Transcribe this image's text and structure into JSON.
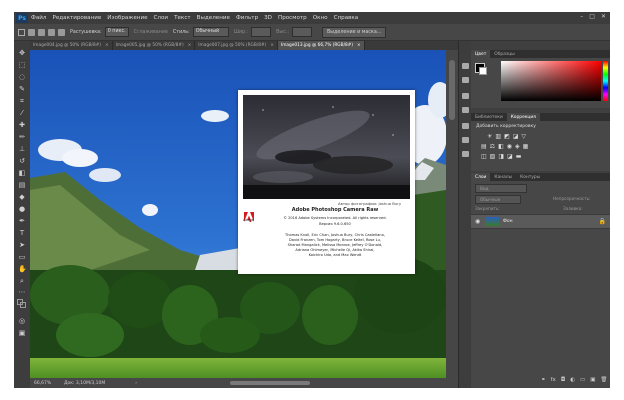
{
  "menu": {
    "logo": "Ps",
    "items": [
      "Файл",
      "Редактирование",
      "Изображение",
      "Слои",
      "Текст",
      "Выделение",
      "Фильтр",
      "3D",
      "Просмотр",
      "Окно",
      "Справка"
    ],
    "min": "–",
    "max": "□",
    "close": "✕"
  },
  "options": {
    "feather_label": "Растушевка:",
    "feather_value": "0 пикс.",
    "antialias_label": "Сглаживание",
    "style_label": "Стиль:",
    "style_value": "Обычный",
    "width_label": "Шир.:",
    "height_label": "Выс.:",
    "select_mask_button": "Выделение и маска..."
  },
  "tabs": [
    {
      "label": "Image004.jpg @ 50% (RGB/8#)",
      "active": false
    },
    {
      "label": "Image005.jpg @ 50% (RGB/8#)",
      "active": false
    },
    {
      "label": "Image007.jpg @ 50% (RGB/8#)",
      "active": false
    },
    {
      "label": "Image013.jpg @ 66,7% (RGB/8#)",
      "active": true
    }
  ],
  "status": {
    "zoom": "66,67%",
    "doc": "Док: 3,10М/3,10М"
  },
  "dialog": {
    "credit": "Автор фотографии: Joshua Bury",
    "adobe": "Adobe",
    "title": "Adobe Photoshop Camera Raw",
    "copyright": "© 2016 Adobe Systems Incorporated. All rights reserved.",
    "version": "Версия 9.6.0.650",
    "credits": [
      "Thomas Knoll, Eric Chan, Joshua Bury, Chris Castellano,",
      "David Franzen, Tom Hogarty, Bruce Keitel, Rose Lu,",
      "Sharad Mangalick, Melissa Monroe, Jeffrey O'Donald,",
      "Adriana Ohlmeyer, Michelle Qi, Akiko Shirai,",
      "Koichiro Uda, and Max Wendt"
    ]
  },
  "panels": {
    "color_tabs": [
      "Цвет",
      "Образцы"
    ],
    "adjust_tabs": [
      "Библиотеки",
      "Коррекция"
    ],
    "adjust_title": "Добавить корректировку",
    "layers_tabs": [
      "Слои",
      "Каналы",
      "Контуры"
    ],
    "kind_placeholder": "Вид",
    "blend_mode": "Обычные",
    "opacity_label": "Непрозрачность:",
    "lock_label": "Закрепить:",
    "fill_label": "Заливка:",
    "layer_name": "Фон"
  },
  "colors": {
    "fg": "#000000",
    "bg": "#ffffff",
    "color_field": "#ff0000"
  }
}
